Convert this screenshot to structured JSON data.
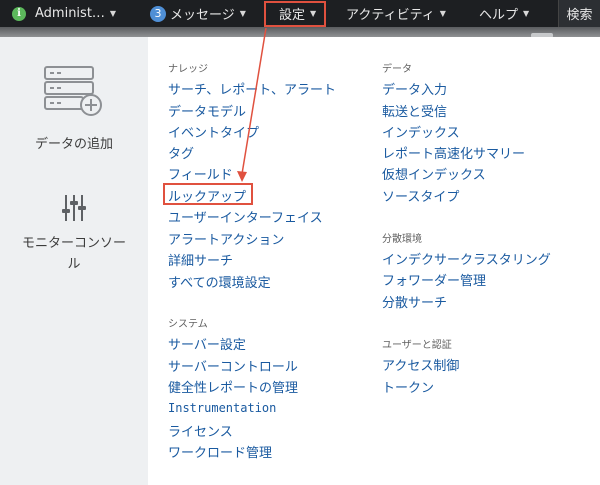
{
  "topbar": {
    "user_icon": "i",
    "user_label": "Administ…",
    "messages_count": "3",
    "messages_label": "メッセージ",
    "settings_label": "設定",
    "activity_label": "アクティビティ",
    "help_label": "ヘルプ",
    "search_label": "検索",
    "caret": "▼"
  },
  "left_menu": {
    "add_data_label": "データの追加",
    "add_data_icon": "server-add-icon",
    "monitor_console_label_line1": "モニターコンソー",
    "monitor_console_label_line2": "ル",
    "monitor_console_icon": "sliders-icon"
  },
  "knowledge": {
    "heading": "ナレッジ",
    "items": [
      "サーチ、レポート、アラート",
      "データモデル",
      "イベントタイプ",
      "タグ",
      "フィールド",
      "ルックアップ",
      "ユーザーインターフェイス",
      "アラートアクション",
      "詳細サーチ",
      "すべての環境設定"
    ]
  },
  "system": {
    "heading": "システム",
    "items": [
      "サーバー設定",
      "サーバーコントロール",
      "健全性レポートの管理",
      "Instrumentation",
      "ライセンス",
      "ワークロード管理"
    ]
  },
  "data": {
    "heading": "データ",
    "items": [
      "データ入力",
      "転送と受信",
      "インデックス",
      "レポート高速化サマリー",
      "仮想インデックス",
      "ソースタイプ"
    ]
  },
  "distributed": {
    "heading": "分散環境",
    "items": [
      "インデクサークラスタリング",
      "フォワーダー管理",
      "分散サーチ"
    ]
  },
  "users_auth": {
    "heading": "ユーザーと認証",
    "items": [
      "アクセス制御",
      "トークン"
    ]
  },
  "colors": {
    "topbar_bg": "#1d1f22",
    "link": "#1a5aa0",
    "highlight": "#e0513f",
    "left_panel_bg": "#eef0f2"
  }
}
